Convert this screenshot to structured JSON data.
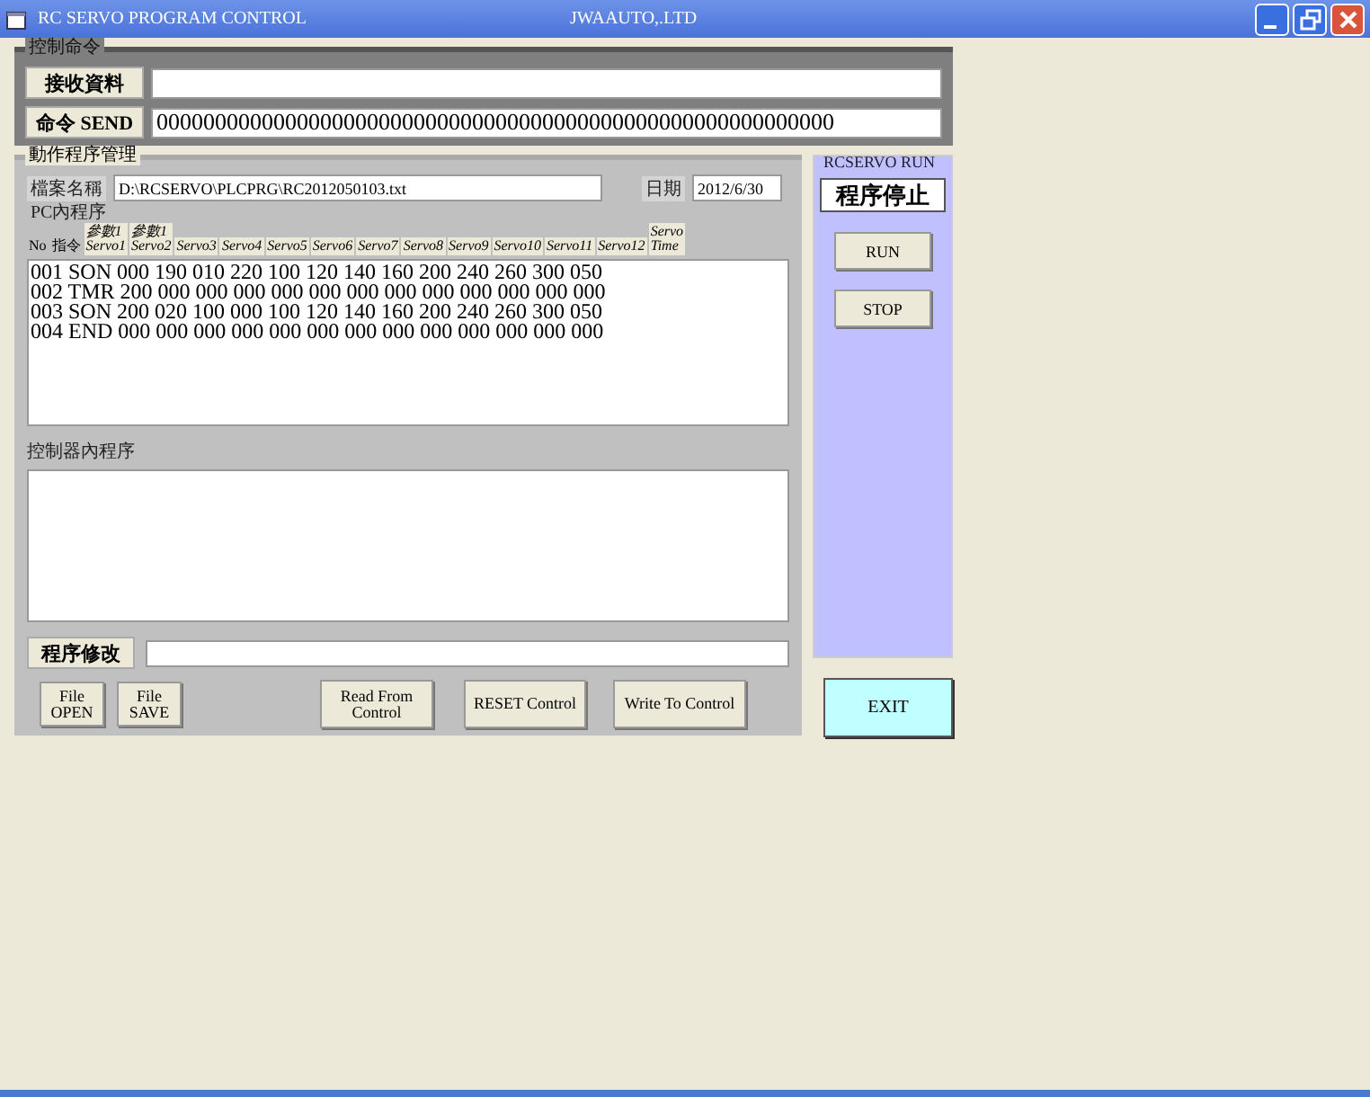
{
  "window": {
    "title": "RC SERVO PROGRAM CONTROL",
    "company": "JWAAUTO,.LTD"
  },
  "command": {
    "title": "控制命令",
    "receive_label": "接收資料",
    "send_button": "命令 SEND",
    "send_value": "0000000000000000000000000000000000000000000000000000000000"
  },
  "program": {
    "title": "動作程序管理",
    "file_label": "檔案名稱",
    "file_value": "D:\\RCSERVO\\PLCPRG\\RC2012050103.txt",
    "date_label": "日期",
    "date_value": "2012/6/30",
    "pc_label": "PC內程序",
    "columns": [
      {
        "lines": [
          "No"
        ],
        "boxed": false
      },
      {
        "lines": [
          "指令"
        ],
        "boxed": false
      },
      {
        "lines": [
          "參數1",
          "Servo1"
        ],
        "boxed": true
      },
      {
        "lines": [
          "參數1",
          "Servo2"
        ],
        "boxed": true
      },
      {
        "lines": [
          "Servo3"
        ],
        "boxed": true
      },
      {
        "lines": [
          "Servo4"
        ],
        "boxed": true
      },
      {
        "lines": [
          "Servo5"
        ],
        "boxed": true
      },
      {
        "lines": [
          "Servo6"
        ],
        "boxed": true
      },
      {
        "lines": [
          "Servo7"
        ],
        "boxed": true
      },
      {
        "lines": [
          "Servo8"
        ],
        "boxed": true
      },
      {
        "lines": [
          "Servo9"
        ],
        "boxed": true
      },
      {
        "lines": [
          "Servo10"
        ],
        "boxed": true
      },
      {
        "lines": [
          "Servo11"
        ],
        "boxed": true
      },
      {
        "lines": [
          "Servo12"
        ],
        "boxed": true
      },
      {
        "lines": [
          "Servo",
          "Time"
        ],
        "boxed": true
      }
    ],
    "pc_lines": [
      "001 SON 000 190 010 220 100 120 140 160 200 240 260 300 050",
      "002 TMR 200 000 000 000 000 000 000 000 000 000 000 000 000",
      "003 SON 200 020 100 000 100 120 140 160 200 240 260 300 050",
      "004 END 000 000 000 000 000 000 000 000 000 000 000 000 000"
    ],
    "controller_label": "控制器內程序",
    "edit_button": "程序修改",
    "buttons": [
      {
        "lines": [
          "File",
          "OPEN"
        ]
      },
      {
        "lines": [
          "File",
          "SAVE"
        ]
      },
      {
        "lines": [
          "Read From",
          "Control"
        ]
      },
      {
        "lines": [
          "RESET Control"
        ]
      },
      {
        "lines": [
          "Write To Control"
        ]
      }
    ]
  },
  "run": {
    "title": "RCSERVO RUN",
    "status": "程序停止",
    "buttons": [
      "RUN",
      "STOP"
    ]
  },
  "exit_button": "EXIT"
}
